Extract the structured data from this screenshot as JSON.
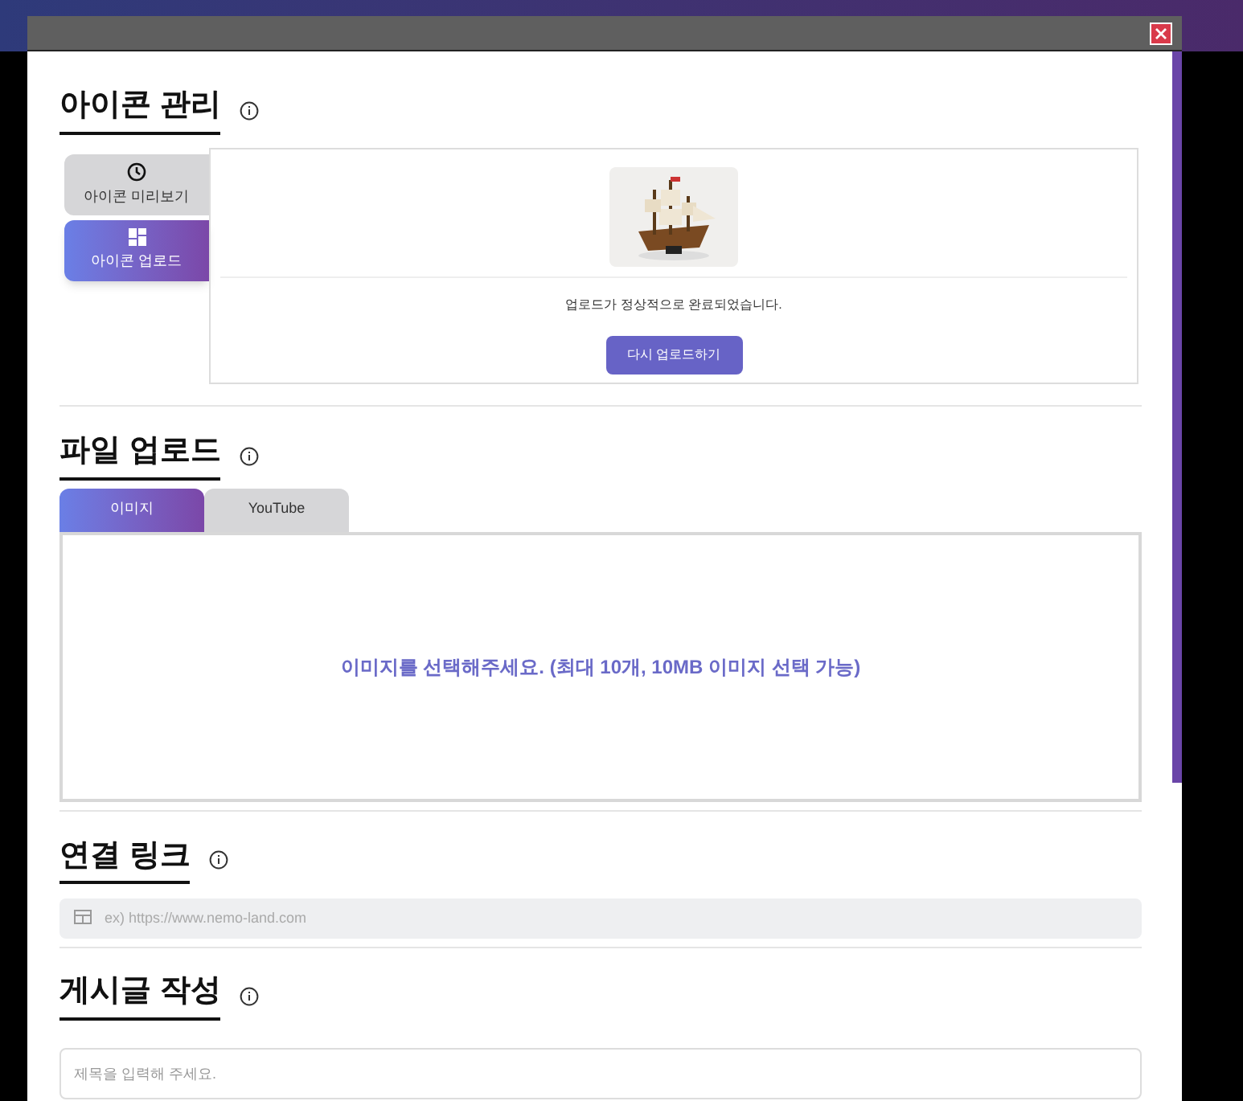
{
  "icon_section": {
    "title": "아이콘 관리",
    "tabs": [
      {
        "kind": "clock",
        "label": "아이콘 미리보기",
        "selected": false
      },
      {
        "kind": "grid",
        "label": "아이콘 업로드",
        "selected": true
      }
    ],
    "preview": {
      "message": "업로드가 정상적으로 완료되었습니다.",
      "button": "다시 업로드하기"
    }
  },
  "file_section": {
    "title": "파일 업로드",
    "tabs": [
      {
        "label": "이미지",
        "selected": true
      },
      {
        "label": "YouTube",
        "selected": false
      }
    ],
    "drop_hint": "이미지를 선택해주세요. (최대 10개, 10MB 이미지 선택 가능)"
  },
  "link_section": {
    "title": "연결 링크",
    "placeholder": "ex) https://www.nemo-land.com"
  },
  "post_section": {
    "title": "게시글 작성",
    "placeholder": "제목을 입력해 주세요."
  }
}
